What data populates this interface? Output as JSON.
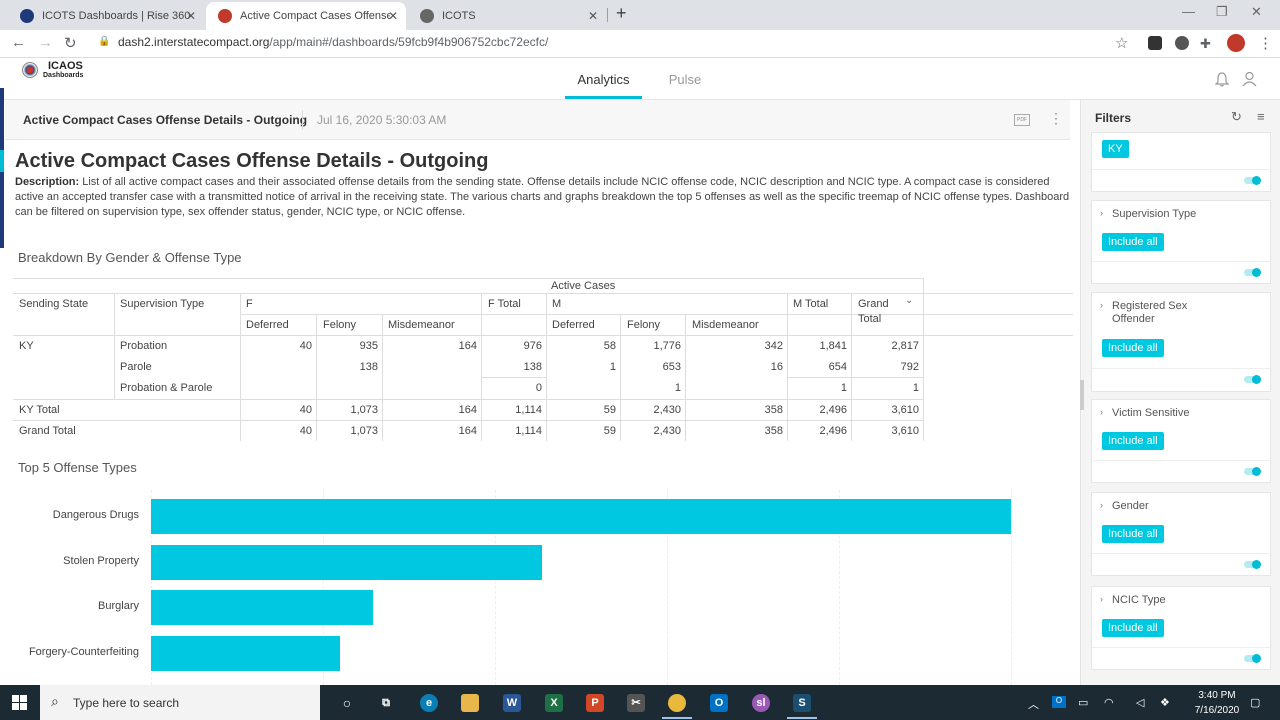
{
  "browser": {
    "tabs": [
      {
        "title": "ICOTS Dashboards | Rise 360",
        "active": false
      },
      {
        "title": "Active Compact Cases Offense D",
        "active": true
      },
      {
        "title": "ICOTS",
        "active": false
      }
    ],
    "url_domain": "dash2.interstatecompact.org",
    "url_path": "/app/main#/dashboards/59fcb9f4b906752cbc72ecfc/"
  },
  "app": {
    "logo_line1": "ICAOS",
    "logo_line2": "Dashboards",
    "nav": {
      "analytics": "Analytics",
      "pulse": "Pulse"
    }
  },
  "dashboard": {
    "header_title": "Active Compact Cases Offense Details - Outgoing",
    "header_date": "Jul 16, 2020 5:30:03 AM",
    "pdf_label": "PDF",
    "title": "Active Compact Cases Offense Details - Outgoing",
    "description_label": "Description:",
    "description": " List of all active compact cases and their associated offense details from the sending state. Offense details include NCIC offense code, NCIC description and NCIC type. A compact case is considered active an accepted transfer case with a transmitted notice of arrival in the receiving state. The various charts and graphs breakdown the top 5 offenses as well as the specific treemap of NCIC offense types. Dashboard can be filtered on supervision type, sex offender status, gender, NCIC type, or NCIC offense.",
    "section1_title": "Breakdown By Gender & Offense Type",
    "section2_title": "Top 5 Offense Types"
  },
  "pivot": {
    "active_cases": "Active Cases",
    "sending_state": "Sending State",
    "supervision_type": "Supervision Type",
    "f": "F",
    "f_total": "F Total",
    "m": "M",
    "m_total": "M Total",
    "grand_total_line1": "Grand",
    "grand_total_line2": "Total",
    "f_sub": [
      "Deferred",
      "Felony",
      "Misdemeanor"
    ],
    "m_sub": [
      "Deferred",
      "Felony",
      "Misdemeanor"
    ],
    "state": "KY",
    "rows": [
      {
        "type": "Probation",
        "f": [
          "40",
          "935",
          "164"
        ],
        "f_total": "976",
        "m": [
          "58",
          "1,776",
          "342"
        ],
        "m_total": "1,841",
        "grand": "2,817"
      },
      {
        "type": "Parole",
        "f": [
          "",
          "138",
          ""
        ],
        "f_total": "138",
        "m": [
          "1",
          "653",
          "16"
        ],
        "m_total": "654",
        "grand": "792"
      },
      {
        "type": "Probation & Parole",
        "f": [
          "",
          "",
          ""
        ],
        "f_total": "0",
        "m": [
          "",
          "1",
          ""
        ],
        "m_total": "1",
        "grand": "1"
      }
    ],
    "ky_total": {
      "label": "KY Total",
      "f": [
        "40",
        "1,073",
        "164"
      ],
      "f_total": "1,114",
      "m": [
        "59",
        "2,430",
        "358"
      ],
      "m_total": "2,496",
      "grand": "3,610"
    },
    "grand_total": {
      "label": "Grand Total",
      "f": [
        "40",
        "1,073",
        "164"
      ],
      "f_total": "1,114",
      "m": [
        "59",
        "2,430",
        "358"
      ],
      "m_total": "2,496",
      "grand": "3,610"
    }
  },
  "chart_data": {
    "type": "bar",
    "orientation": "horizontal",
    "title": "Top 5 Offense Types",
    "categories": [
      "Dangerous Drugs",
      "Stolen Property",
      "Burglary",
      "Forgery-Counterfeiting"
    ],
    "values": [
      1000,
      455,
      258,
      220
    ],
    "xlim": [
      0,
      1000
    ],
    "color": "#00c8e0"
  },
  "filters": {
    "title": "Filters",
    "cards": [
      {
        "name": "",
        "chip": "KY"
      },
      {
        "name": "Supervision Type",
        "chip": "Include all"
      },
      {
        "name": "Registered Sex Offender",
        "chip": "Include all"
      },
      {
        "name": "Victim Sensitive",
        "chip": "Include all"
      },
      {
        "name": "Gender",
        "chip": "Include all"
      },
      {
        "name": "NCIC Type",
        "chip": "Include all"
      }
    ]
  },
  "taskbar": {
    "search_placeholder": "Type here to search",
    "time": "3:40 PM",
    "date": "7/16/2020"
  },
  "colors": {
    "accent": "#00bcd4",
    "bar": "#00c8e0",
    "taskbar": "#1c2b33"
  }
}
